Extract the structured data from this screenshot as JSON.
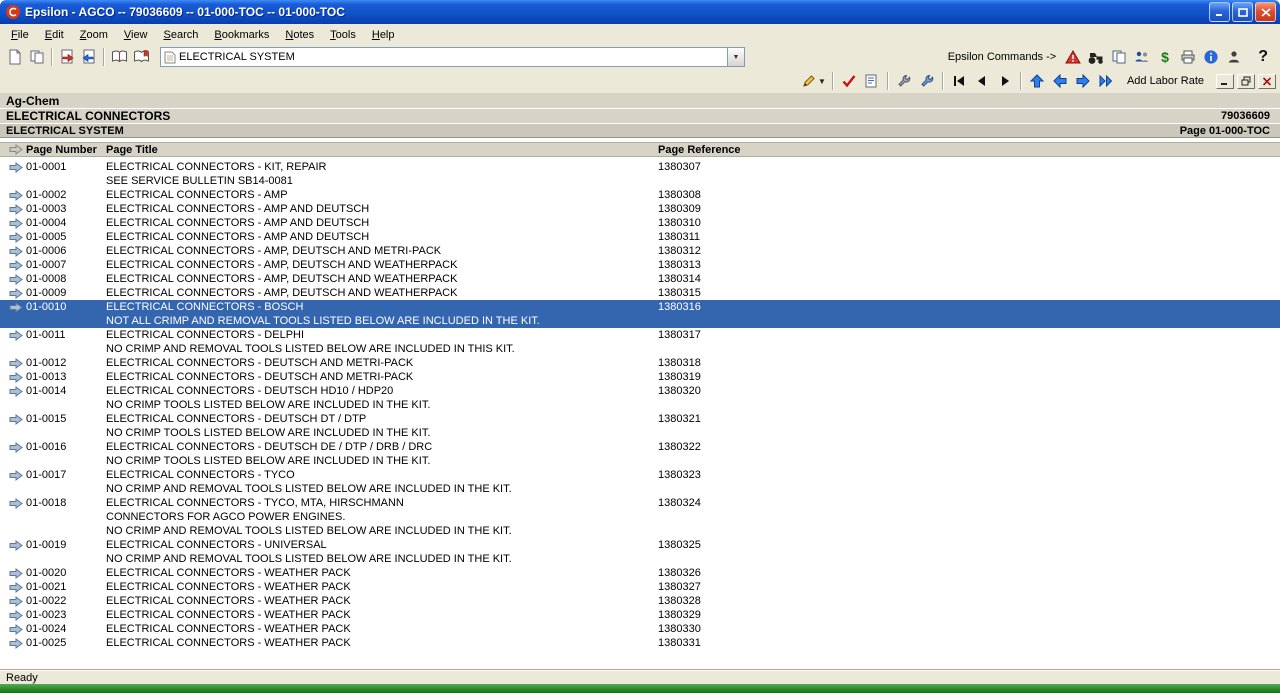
{
  "colors": {
    "titlebar-top": "#3c8cf8",
    "titlebar-bottom": "#0a3daa",
    "selection": "#3466b0",
    "chrome": "#ece9d8",
    "band": "#d7d3c7",
    "band-dark": "#cbc7bb",
    "taskbar-green": "#2e8b2e"
  },
  "window": {
    "title": "Epsilon - AGCO -- 79036609 -- 01-000-TOC -- 01-000-TOC",
    "controls": [
      "minimize",
      "maximize",
      "close"
    ]
  },
  "menu": {
    "items": [
      "File",
      "Edit",
      "Zoom",
      "View",
      "Search",
      "Bookmarks",
      "Notes",
      "Tools",
      "Help"
    ]
  },
  "toolbar_main": {
    "left_icons": [
      "new-document-icon",
      "documents-icon",
      "goto-page-icon",
      "find-page-icon",
      "open-book-icon",
      "bookmarks-icon"
    ],
    "combo_value": "ELECTRICAL SYSTEM",
    "combo_icon": "document-icon",
    "commands_label": "Epsilon Commands ->",
    "right_icons": [
      "warning-icon",
      "tractor-icon",
      "copy-icon",
      "group-icon",
      "dollar-icon",
      "printer-icon",
      "info-icon",
      "user-icon"
    ],
    "help_label": "?"
  },
  "toolbar_nav": {
    "icons": [
      "edit-icon",
      "checkmark-icon",
      "notes-icon",
      "tool-icon",
      "hand-tool-icon",
      "first-page-icon",
      "prev-page-icon",
      "next-page-icon",
      "up-icon",
      "back-icon",
      "forward-icon",
      "skip-forward-icon"
    ],
    "add_labor_rate": "Add Labor Rate",
    "window_controls": [
      "minimize",
      "restore",
      "close"
    ]
  },
  "header": {
    "brand": "Ag-Chem",
    "title": "ELECTRICAL CONNECTORS",
    "code": "79036609",
    "section": "ELECTRICAL SYSTEM",
    "page_ref": "Page 01-000-TOC"
  },
  "table": {
    "columns": [
      "Page Number",
      "Page Title",
      "Page Reference"
    ],
    "rows": [
      {
        "page": "01-0001",
        "title": "ELECTRICAL CONNECTORS - KIT, REPAIR",
        "ref": "1380307",
        "notes": [
          "SEE SERVICE BULLETIN SB14-0081"
        ],
        "selected": false
      },
      {
        "page": "01-0002",
        "title": "ELECTRICAL CONNECTORS - AMP",
        "ref": "1380308",
        "notes": [],
        "selected": false
      },
      {
        "page": "01-0003",
        "title": "ELECTRICAL CONNECTORS - AMP AND DEUTSCH",
        "ref": "1380309",
        "notes": [],
        "selected": false
      },
      {
        "page": "01-0004",
        "title": "ELECTRICAL CONNECTORS - AMP AND DEUTSCH",
        "ref": "1380310",
        "notes": [],
        "selected": false
      },
      {
        "page": "01-0005",
        "title": "ELECTRICAL CONNECTORS - AMP AND DEUTSCH",
        "ref": "1380311",
        "notes": [],
        "selected": false
      },
      {
        "page": "01-0006",
        "title": "ELECTRICAL CONNECTORS - AMP, DEUTSCH AND METRI-PACK",
        "ref": "1380312",
        "notes": [],
        "selected": false
      },
      {
        "page": "01-0007",
        "title": "ELECTRICAL CONNECTORS - AMP, DEUTSCH AND WEATHERPACK",
        "ref": "1380313",
        "notes": [],
        "selected": false
      },
      {
        "page": "01-0008",
        "title": "ELECTRICAL CONNECTORS - AMP, DEUTSCH AND WEATHERPACK",
        "ref": "1380314",
        "notes": [],
        "selected": false
      },
      {
        "page": "01-0009",
        "title": "ELECTRICAL CONNECTORS - AMP, DEUTSCH AND WEATHERPACK",
        "ref": "1380315",
        "notes": [],
        "selected": false
      },
      {
        "page": "01-0010",
        "title": "ELECTRICAL CONNECTORS - BOSCH",
        "ref": "1380316",
        "notes": [
          "NOT ALL CRIMP AND REMOVAL TOOLS LISTED BELOW ARE INCLUDED IN THE KIT."
        ],
        "selected": true
      },
      {
        "page": "01-0011",
        "title": "ELECTRICAL CONNECTORS - DELPHI",
        "ref": "1380317",
        "notes": [
          "NO CRIMP AND REMOVAL TOOLS LISTED BELOW ARE INCLUDED IN THIS KIT."
        ],
        "selected": false
      },
      {
        "page": "01-0012",
        "title": "ELECTRICAL CONNECTORS - DEUTSCH AND METRI-PACK",
        "ref": "1380318",
        "notes": [],
        "selected": false
      },
      {
        "page": "01-0013",
        "title": "ELECTRICAL CONNECTORS - DEUTSCH AND METRI-PACK",
        "ref": "1380319",
        "notes": [],
        "selected": false
      },
      {
        "page": "01-0014",
        "title": "ELECTRICAL CONNECTORS - DEUTSCH HD10 / HDP20",
        "ref": "1380320",
        "notes": [
          "NO CRIMP TOOLS LISTED BELOW ARE INCLUDED IN THE KIT."
        ],
        "selected": false
      },
      {
        "page": "01-0015",
        "title": "ELECTRICAL CONNECTORS - DEUTSCH DT / DTP",
        "ref": "1380321",
        "notes": [
          "NO CRIMP TOOLS LISTED BELOW ARE INCLUDED IN THE KIT."
        ],
        "selected": false
      },
      {
        "page": "01-0016",
        "title": "ELECTRICAL CONNECTORS - DEUTSCH DE / DTP / DRB / DRC",
        "ref": "1380322",
        "notes": [
          "NO CRIMP TOOLS LISTED BELOW ARE INCLUDED IN THE KIT."
        ],
        "selected": false
      },
      {
        "page": "01-0017",
        "title": "ELECTRICAL CONNECTORS - TYCO",
        "ref": "1380323",
        "notes": [
          "NO CRIMP AND REMOVAL TOOLS LISTED BELOW ARE INCLUDED IN THE KIT."
        ],
        "selected": false
      },
      {
        "page": "01-0018",
        "title": "ELECTRICAL CONNECTORS - TYCO, MTA, HIRSCHMANN",
        "ref": "1380324",
        "notes": [
          "CONNECTORS FOR AGCO POWER ENGINES.",
          "NO CRIMP AND REMOVAL TOOLS LISTED BELOW ARE INCLUDED IN THE KIT."
        ],
        "selected": false
      },
      {
        "page": "01-0019",
        "title": "ELECTRICAL CONNECTORS - UNIVERSAL",
        "ref": "1380325",
        "notes": [
          "NO CRIMP AND REMOVAL TOOLS LISTED BELOW ARE INCLUDED IN THE KIT."
        ],
        "selected": false
      },
      {
        "page": "01-0020",
        "title": "ELECTRICAL CONNECTORS - WEATHER PACK",
        "ref": "1380326",
        "notes": [],
        "selected": false
      },
      {
        "page": "01-0021",
        "title": "ELECTRICAL CONNECTORS - WEATHER PACK",
        "ref": "1380327",
        "notes": [],
        "selected": false
      },
      {
        "page": "01-0022",
        "title": "ELECTRICAL CONNECTORS - WEATHER PACK",
        "ref": "1380328",
        "notes": [],
        "selected": false
      },
      {
        "page": "01-0023",
        "title": "ELECTRICAL CONNECTORS - WEATHER PACK",
        "ref": "1380329",
        "notes": [],
        "selected": false
      },
      {
        "page": "01-0024",
        "title": "ELECTRICAL CONNECTORS - WEATHER PACK",
        "ref": "1380330",
        "notes": [],
        "selected": false
      },
      {
        "page": "01-0025",
        "title": "ELECTRICAL CONNECTORS - WEATHER PACK",
        "ref": "1380331",
        "notes": [],
        "selected": false
      }
    ]
  },
  "status": {
    "text": "Ready"
  }
}
